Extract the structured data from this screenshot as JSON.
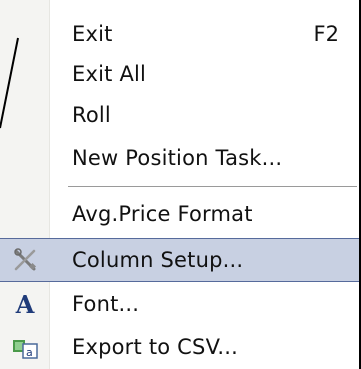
{
  "menu": {
    "items": [
      {
        "label": "Exit",
        "shortcut": "F2"
      },
      {
        "label": "Exit All"
      },
      {
        "label": "Roll"
      },
      {
        "label": "New Position Task..."
      },
      {
        "label": "Avg.Price Format"
      },
      {
        "label": "Column Setup...",
        "icon": "tools-icon",
        "highlighted": true
      },
      {
        "label": "Font...",
        "icon": "font-icon"
      },
      {
        "label": "Export to CSV...",
        "icon": "spreadsheet-export-icon"
      }
    ]
  },
  "icons": {
    "font_glyph": "A"
  },
  "colors": {
    "highlight_bg": "#c8d0e2",
    "highlight_border": "#566a9b",
    "gutter": "#f4f4f2"
  }
}
